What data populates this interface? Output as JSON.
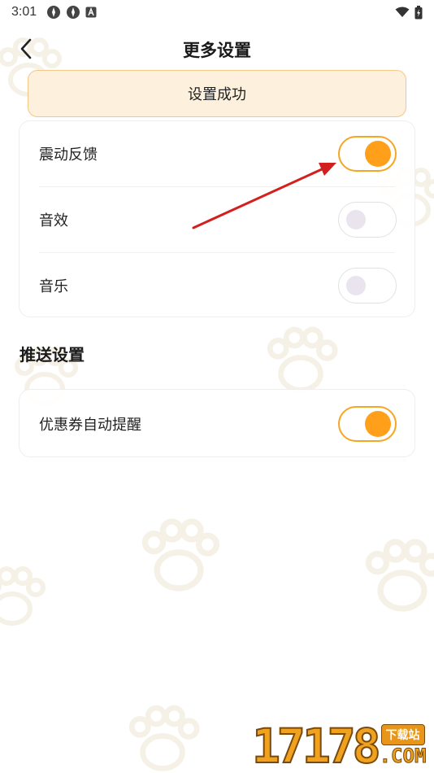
{
  "status_bar": {
    "time": "3:01"
  },
  "header": {
    "title": "更多设置"
  },
  "toast": {
    "message": "设置成功"
  },
  "settings": [
    {
      "label": "震动反馈",
      "enabled": true
    },
    {
      "label": "音效",
      "enabled": false
    },
    {
      "label": "音乐",
      "enabled": false
    }
  ],
  "push_section": {
    "title": "推送设置",
    "items": [
      {
        "label": "优惠券自动提醒",
        "enabled": true
      }
    ]
  },
  "colors": {
    "accent": "#ff9f1a",
    "toggle_on_border": "#f5a623",
    "toast_bg": "#fdf1dd",
    "toast_border": "#f3c785",
    "annotation_arrow": "#d41f1f"
  },
  "watermark": {
    "digits": "17178",
    "badge": "下载站",
    "domain": ".COM"
  }
}
